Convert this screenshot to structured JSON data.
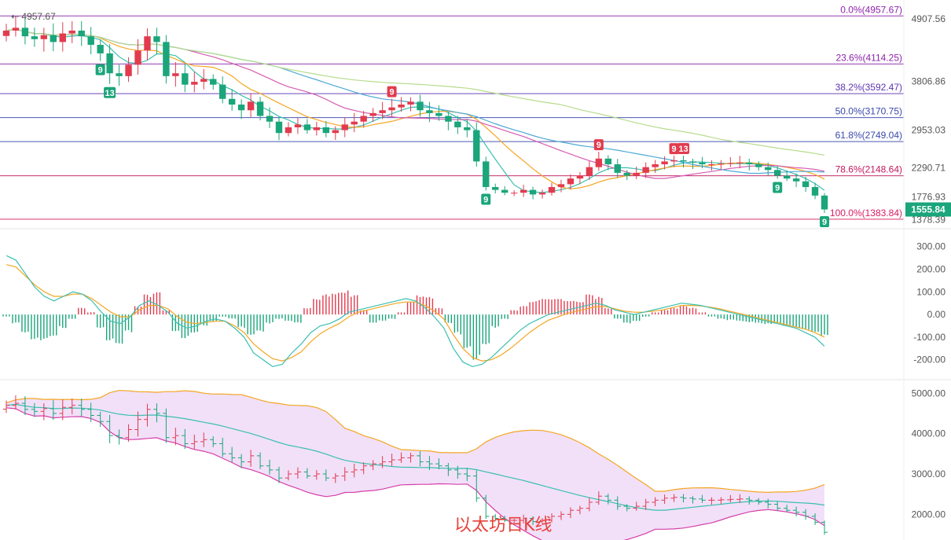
{
  "chart_data": [
    {
      "type": "candlestick",
      "panel": "price",
      "high_label": "4957.67",
      "current_price": "1555.84",
      "yticks": [
        "4907.56",
        "3806.86",
        "2953.03",
        "2290.71",
        "1776.93",
        "1378.39"
      ],
      "ylim": [
        1300,
        5100
      ],
      "fib_levels": [
        {
          "label": "0.0%(4957.67)",
          "value": 4957.67,
          "color": "#8e24aa"
        },
        {
          "label": "23.6%(4114.25)",
          "value": 4114.25,
          "color": "#8e24aa"
        },
        {
          "label": "38.2%(3592.47)",
          "value": 3592.47,
          "color": "#5e35b1"
        },
        {
          "label": "50.0%(3170.75)",
          "value": 3170.75,
          "color": "#3949ab"
        },
        {
          "label": "61.8%(2749.04)",
          "value": 2749.04,
          "color": "#3949ab"
        },
        {
          "label": "78.6%(2148.64)",
          "value": 2148.64,
          "color": "#c2185b"
        },
        {
          "label": "100.0%(1383.84)",
          "value": 1383.84,
          "color": "#d81b60"
        }
      ],
      "td_markers": [
        {
          "label": "9",
          "color": "#1aa57a",
          "bar": 10
        },
        {
          "label": "13",
          "color": "#1aa57a",
          "bar": 11
        },
        {
          "label": "9",
          "color": "#e23b4e",
          "bar": 41
        },
        {
          "label": "9",
          "color": "#1aa57a",
          "bar": 51
        },
        {
          "label": "9",
          "color": "#e23b4e",
          "bar": 63
        },
        {
          "label": "9",
          "color": "#e23b4e",
          "bar": 71
        },
        {
          "label": "13",
          "color": "#e23b4e",
          "bar": 72
        },
        {
          "label": "9",
          "color": "#1aa57a",
          "bar": 82
        },
        {
          "label": "9",
          "color": "#1aa57a",
          "bar": 87
        }
      ],
      "closes": [
        4700,
        4750,
        4600,
        4550,
        4620,
        4500,
        4650,
        4700,
        4600,
        4450,
        4300,
        3950,
        3900,
        4100,
        4350,
        4600,
        4500,
        3900,
        3950,
        3750,
        3800,
        3850,
        3750,
        3500,
        3400,
        3300,
        3450,
        3200,
        3100,
        2900,
        3000,
        3050,
        2950,
        3000,
        2900,
        2950,
        3050,
        3100,
        3200,
        3250,
        3300,
        3350,
        3400,
        3450,
        3300,
        3250,
        3200,
        3100,
        3000,
        2950,
        2400,
        1950,
        1900,
        1850,
        1850,
        1900,
        1820,
        1850,
        1950,
        2000,
        2100,
        2150,
        2300,
        2450,
        2350,
        2200,
        2150,
        2200,
        2300,
        2350,
        2400,
        2420,
        2400,
        2380,
        2350,
        2350,
        2360,
        2370,
        2380,
        2350,
        2300,
        2250,
        2150,
        2100,
        2050,
        1950,
        1800,
        1556
      ],
      "type_note": "daily"
    },
    {
      "type": "bar",
      "panel": "macd",
      "yticks": [
        "300.00",
        "200.00",
        "100.00",
        "0.00",
        "-100.00",
        "-200.00"
      ],
      "ylim": [
        -260,
        330
      ],
      "histogram": [
        -10,
        -40,
        -80,
        -110,
        -115,
        -100,
        -60,
        -20,
        30,
        10,
        -60,
        -120,
        -130,
        -80,
        40,
        90,
        100,
        20,
        -80,
        -110,
        -90,
        -50,
        -30,
        -10,
        -20,
        -60,
        -90,
        -80,
        -40,
        -20,
        -30,
        -40,
        30,
        70,
        90,
        100,
        110,
        90,
        20,
        -40,
        -30,
        -20,
        10,
        60,
        90,
        80,
        30,
        -40,
        -90,
        -150,
        -200,
        -140,
        -60,
        -20,
        20,
        40,
        60,
        70,
        75,
        70,
        65,
        60,
        90,
        80,
        30,
        -20,
        -40,
        -30,
        -10,
        10,
        20,
        30,
        40,
        30,
        10,
        -10,
        -20,
        -25,
        -30,
        -35,
        -40,
        -45,
        -40,
        -50,
        -60,
        -70,
        -80,
        -95
      ],
      "dif": [
        260,
        240,
        180,
        120,
        80,
        60,
        80,
        100,
        90,
        60,
        10,
        -30,
        -40,
        -10,
        40,
        60,
        40,
        10,
        -40,
        -60,
        -50,
        -30,
        -20,
        -30,
        -60,
        -100,
        -170,
        -200,
        -230,
        -220,
        -170,
        -130,
        -80,
        -50,
        -40,
        -20,
        10,
        20,
        30,
        40,
        50,
        60,
        70,
        60,
        30,
        -10,
        -60,
        -150,
        -210,
        -230,
        -220,
        -190,
        -150,
        -110,
        -70,
        -40,
        -20,
        0,
        10,
        20,
        30,
        40,
        50,
        40,
        20,
        10,
        0,
        10,
        20,
        30,
        40,
        50,
        45,
        40,
        30,
        20,
        10,
        0,
        -10,
        -20,
        -30,
        -40,
        -50,
        -60,
        -80,
        -100,
        -140
      ],
      "dea": [
        220,
        210,
        170,
        130,
        100,
        80,
        80,
        90,
        90,
        70,
        40,
        10,
        -10,
        -10,
        20,
        40,
        40,
        25,
        -10,
        -35,
        -40,
        -35,
        -30,
        -30,
        -50,
        -80,
        -130,
        -165,
        -195,
        -205,
        -190,
        -165,
        -120,
        -85,
        -60,
        -40,
        -10,
        10,
        20,
        30,
        40,
        50,
        55,
        55,
        40,
        15,
        -20,
        -90,
        -150,
        -190,
        -205,
        -200,
        -180,
        -150,
        -115,
        -80,
        -50,
        -25,
        -10,
        5,
        15,
        25,
        35,
        35,
        25,
        15,
        10,
        10,
        15,
        20,
        30,
        40,
        40,
        38,
        32,
        25,
        15,
        5,
        -5,
        -15,
        -25,
        -35,
        -45,
        -55,
        -65,
        -80,
        -100
      ]
    },
    {
      "type": "candlestick",
      "panel": "bollinger",
      "yticks": [
        "5000.00",
        "4000.00",
        "3000.00",
        "2000.00"
      ],
      "ylim": [
        1500,
        5200
      ]
    }
  ],
  "caption": "以太坊日K线"
}
